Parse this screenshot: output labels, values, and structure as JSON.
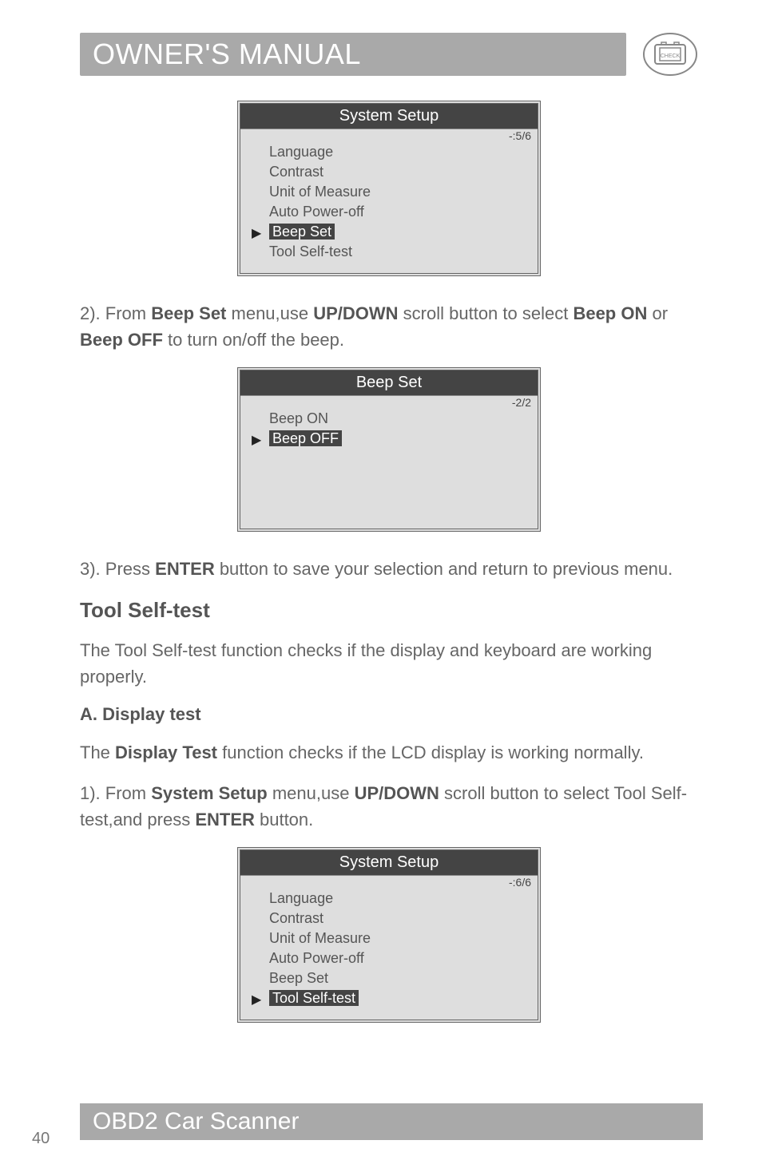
{
  "header": {
    "title": "OWNER'S MANUAL",
    "icon_label": "CHECK"
  },
  "lcd1": {
    "title": "System Setup",
    "counter": "-:5/6",
    "items": [
      "Language",
      "Contrast",
      "Unit of Measure",
      "Auto Power-off",
      "Beep Set",
      "Tool Self-test"
    ],
    "selected_index": 4
  },
  "para1": "2). From Beep Set menu,use UP/DOWN scroll button to select Beep ON or Beep OFF to turn on/off the beep.",
  "lcd2": {
    "title": "Beep Set",
    "counter": "-2/2",
    "items": [
      "Beep ON",
      "Beep OFF"
    ],
    "selected_index": 1
  },
  "para2": "3). Press ENTER button to save your selection and return to previous menu.",
  "h2": "Tool Self-test",
  "para3": "The Tool Self-test function checks if the display and keyboard are working properly.",
  "h3": "A. Display test",
  "para4": "The Display Test function checks if the LCD display is working normally.",
  "para5": "1). From System Setup menu,use UP/DOWN scroll button to select Tool Self-test,and press ENTER button.",
  "lcd3": {
    "title": "System Setup",
    "counter": "-:6/6",
    "items": [
      "Language",
      "Contrast",
      "Unit of Measure",
      "Auto Power-off",
      "Beep Set",
      "Tool Self-test"
    ],
    "selected_index": 5
  },
  "footer": {
    "title": "OBD2 Car Scanner"
  },
  "page_number": "40",
  "bold_terms": [
    "Beep Set",
    "UP/DOWN",
    "Beep ON",
    "Beep OFF",
    "ENTER",
    "Display Test",
    "System Setup"
  ]
}
